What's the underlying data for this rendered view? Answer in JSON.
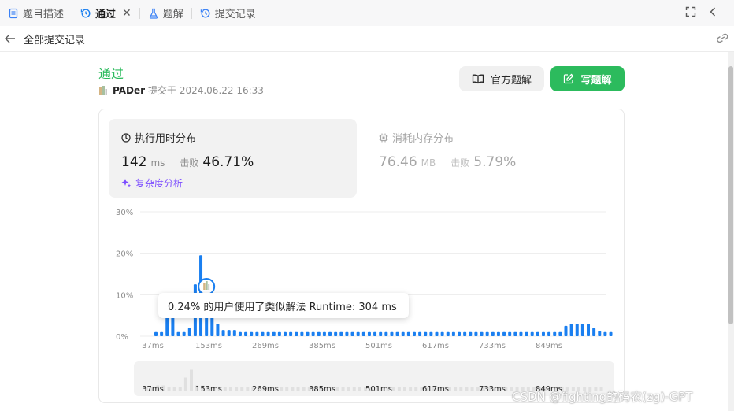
{
  "tabs": [
    {
      "label": "题目描述",
      "icon": "document-icon",
      "active": false
    },
    {
      "label": "通过",
      "icon": "history-icon",
      "active": true,
      "closable": true
    },
    {
      "label": "题解",
      "icon": "flask-icon",
      "active": false
    },
    {
      "label": "提交记录",
      "icon": "history-icon",
      "active": false
    }
  ],
  "subheader": {
    "back_label": "全部提交记录"
  },
  "submission": {
    "status": "通过",
    "user": "PADer",
    "submitted_text": "提交于 2024.06.22 16:33"
  },
  "buttons": {
    "official_solution": "官方题解",
    "write_solution": "写题解"
  },
  "runtime": {
    "title": "执行用时分布",
    "value": "142",
    "unit": "ms",
    "beat_label": "击败",
    "beat_value": "46.71%"
  },
  "memory": {
    "title": "消耗内存分布",
    "value": "76.46",
    "unit": "MB",
    "beat_label": "击败",
    "beat_value": "5.79%"
  },
  "complexity_link": "复杂度分析",
  "tooltip": "0.24% 的用户使用了类似解法 Runtime: 304 ms",
  "colors": {
    "accent_green": "#2cbb5d",
    "bar_blue": "#1a7ff0",
    "purple": "#7c4dff"
  },
  "chart_data": {
    "type": "bar",
    "y_ticks": [
      "30%",
      "20%",
      "10%",
      "0%"
    ],
    "ylim": [
      0,
      30
    ],
    "x_tick_labels": [
      "37ms",
      "153ms",
      "269ms",
      "385ms",
      "501ms",
      "617ms",
      "733ms",
      "849ms"
    ],
    "values": [
      1.0,
      1.0,
      4.5,
      4.5,
      1.0,
      1.0,
      2.0,
      12.5,
      19.5,
      4.5,
      4.5,
      3.0,
      1.5,
      1.5,
      1.5,
      1.0,
      1.0,
      1.0,
      1.0,
      1.0,
      1.0,
      1.0,
      1.0,
      1.0,
      1.0,
      1.0,
      1.0,
      1.0,
      1.0,
      1.0,
      1.0,
      1.0,
      1.0,
      1.0,
      1.0,
      1.0,
      1.0,
      1.0,
      1.0,
      1.0,
      1.0,
      1.0,
      1.0,
      1.0,
      1.0,
      1.0,
      1.0,
      1.0,
      1.0,
      1.0,
      1.0,
      1.0,
      1.0,
      1.0,
      1.0,
      1.0,
      1.0,
      1.0,
      1.0,
      1.0,
      1.0,
      1.0,
      1.0,
      1.0,
      1.0,
      1.0,
      1.0,
      1.0,
      1.0,
      1.0,
      1.0,
      1.0,
      1.0,
      2.5,
      3.0,
      3.0,
      3.0,
      3.0,
      2.0,
      1.2,
      1.0,
      1.0
    ],
    "user_value_ms": 142,
    "mini_values": [
      1.0,
      1.0,
      1.5,
      1.5,
      1.0,
      1.0,
      1.0,
      3.5,
      5.5,
      1.5,
      1.5,
      1.2,
      1.0,
      1.0,
      1.0,
      1.0,
      1.0,
      1.0,
      1.0,
      1.0,
      1.0,
      1.0,
      1.0,
      1.0,
      1.0,
      1.0,
      1.0,
      1.0,
      1.0,
      1.0,
      1.0,
      1.0,
      1.0,
      1.0,
      1.0,
      1.0,
      1.0,
      1.0,
      1.0,
      1.0,
      1.0,
      1.0,
      1.0,
      1.0,
      1.0,
      1.0,
      1.0,
      1.0,
      1.0,
      1.0,
      1.0,
      1.0,
      1.0,
      1.0,
      1.0,
      1.0,
      1.0,
      1.0,
      1.0,
      1.0,
      1.0,
      1.0,
      1.0,
      1.0,
      1.0,
      1.0,
      1.0,
      1.0,
      1.0,
      1.0,
      1.0,
      1.0,
      1.0,
      1.0,
      1.0,
      1.0,
      1.0,
      1.0,
      1.0,
      1.0,
      1.0,
      1.0
    ]
  },
  "watermark": "CSDN @fighting的码农(zg)-GPT"
}
